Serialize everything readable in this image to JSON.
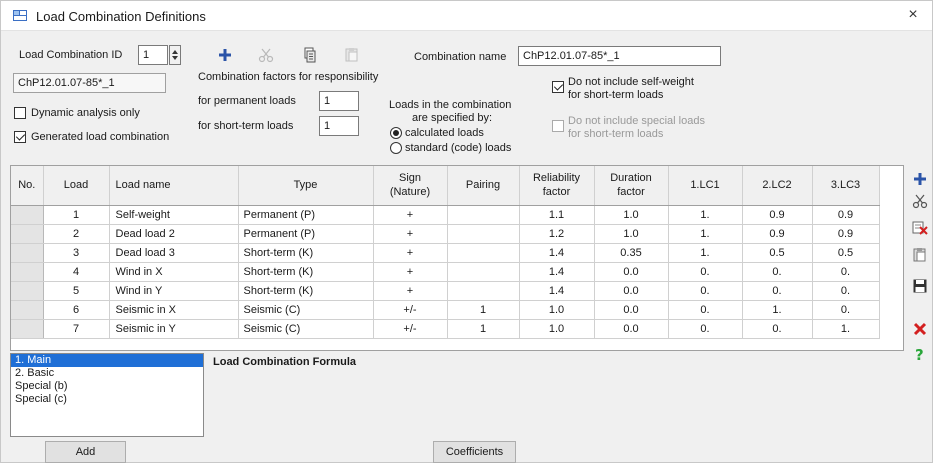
{
  "window": {
    "title": "Load Combination Definitions",
    "close_glyph": "×"
  },
  "header": {
    "lc_id_label": "Load Combination ID",
    "lc_id_value": "1",
    "lc_code_value": "ChP12.01.07-85*_1",
    "dynamic_only_label": "Dynamic analysis only",
    "dynamic_only_checked": false,
    "generated_label": "Generated load combination",
    "generated_checked": true,
    "factors_title": "Combination factors for responsibility",
    "permanent_label": "for permanent loads",
    "permanent_value": "1",
    "shortterm_label": "for short-term loads",
    "shortterm_value": "1",
    "combination_name_label": "Combination name",
    "combination_name_value": "ChP12.01.07-85*_1",
    "specified_label_1": "Loads in the combination",
    "specified_label_2": "are specified by:",
    "radio_calculated": "calculated loads",
    "radio_standard": "standard (code) loads",
    "no_selfweight_label_1": "Do not include self-weight",
    "no_selfweight_label_2": "for short-term loads",
    "no_special_label_1": "Do not include special loads",
    "no_special_label_2": "for short-term loads"
  },
  "toolbar_icons": [
    "add-icon",
    "cut-icon",
    "copy-icon",
    "paste-icon"
  ],
  "table": {
    "columns": [
      "No.",
      "Load",
      "Load name",
      "Type",
      "Sign\n(Nature)",
      "Pairing",
      "Reliability\nfactor",
      "Duration\nfactor",
      "1.LC1",
      "2.LC2",
      "3.LC3"
    ],
    "col_no": "No.",
    "col_load": "Load",
    "col_name": "Load name",
    "col_type": "Type",
    "col_sign_1": "Sign",
    "col_sign_2": "(Nature)",
    "col_pairing": "Pairing",
    "col_rel_1": "Reliability",
    "col_rel_2": "factor",
    "col_dur_1": "Duration",
    "col_dur_2": "factor",
    "col_lc1": "1.LC1",
    "col_lc2": "2.LC2",
    "col_lc3": "3.LC3",
    "rows": [
      {
        "load": "1",
        "name": "Self-weight",
        "type": "Permanent (P)",
        "sign": "+",
        "pairing": "",
        "rel": "1.1",
        "dur": "1.0",
        "lc1": "1.",
        "lc2": "0.9",
        "lc3": "0.9"
      },
      {
        "load": "2",
        "name": "Dead load 2",
        "type": "Permanent (P)",
        "sign": "+",
        "pairing": "",
        "rel": "1.2",
        "dur": "1.0",
        "lc1": "1.",
        "lc2": "0.9",
        "lc3": "0.9"
      },
      {
        "load": "3",
        "name": "Dead load 3",
        "type": "Short-term (K)",
        "sign": "+",
        "pairing": "",
        "rel": "1.4",
        "dur": "0.35",
        "lc1": "1.",
        "lc2": "0.5",
        "lc3": "0.5"
      },
      {
        "load": "4",
        "name": "Wind in X",
        "type": "Short-term (K)",
        "sign": "+",
        "pairing": "",
        "rel": "1.4",
        "dur": "0.0",
        "lc1": "0.",
        "lc2": "0.",
        "lc3": "0."
      },
      {
        "load": "5",
        "name": "Wind in Y",
        "type": "Short-term (K)",
        "sign": "+",
        "pairing": "",
        "rel": "1.4",
        "dur": "0.0",
        "lc1": "0.",
        "lc2": "0.",
        "lc3": "0."
      },
      {
        "load": "6",
        "name": "Seismic in X",
        "type": "Seismic (C)",
        "sign": "+/-",
        "pairing": "1",
        "rel": "1.0",
        "dur": "0.0",
        "lc1": "0.",
        "lc2": "1.",
        "lc3": "0."
      },
      {
        "load": "7",
        "name": "Seismic in Y",
        "type": "Seismic (C)",
        "sign": "+/-",
        "pairing": "1",
        "rel": "1.0",
        "dur": "0.0",
        "lc1": "0.",
        "lc2": "0.",
        "lc3": "1."
      }
    ]
  },
  "side_icons": [
    "add-row-icon",
    "cut-row-icon",
    "delete-row-icon",
    "paste-row-icon",
    "save-icon",
    "close-red-icon",
    "help-icon"
  ],
  "formula": {
    "list_items": [
      "1. Main",
      "2. Basic",
      "Special (b)",
      "Special (c)"
    ],
    "selected_index": 0,
    "title": "Load Combination Formula",
    "add_label": "Add",
    "coefficients_label": "Coefficients"
  },
  "colors": {
    "accent": "#1f6fd6",
    "green": "#2aa63a",
    "red": "#d32020",
    "grid_header": "#f0f0f0"
  }
}
